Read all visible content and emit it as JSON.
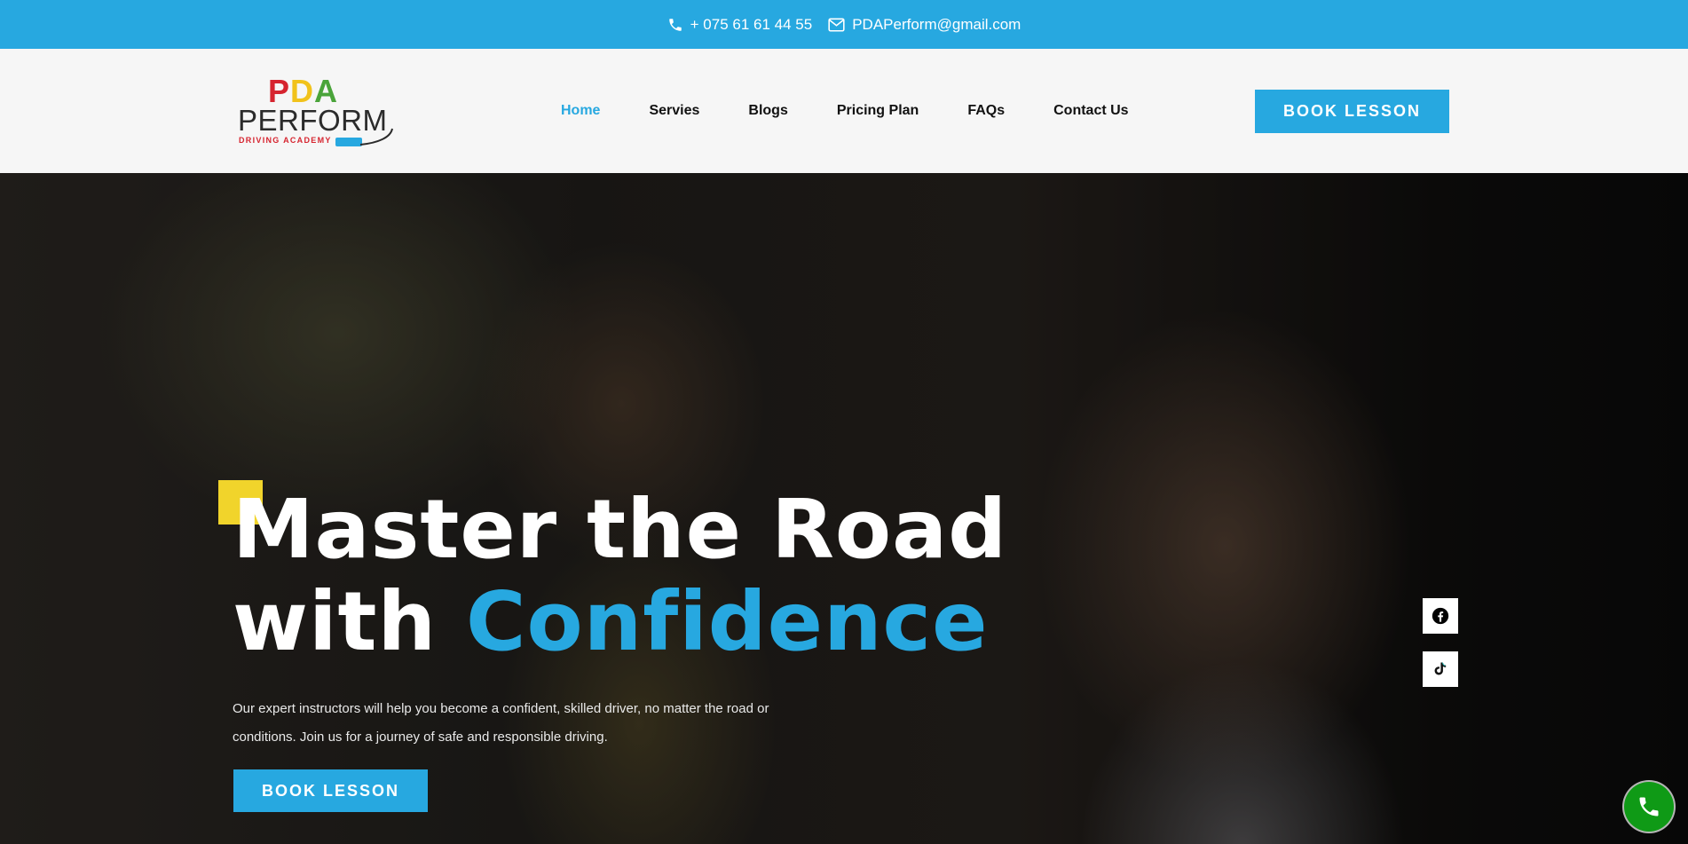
{
  "topbar": {
    "phone": "+ 075 61 61 44 55",
    "email": "PDAPerform@gmail.com",
    "phone_icon": "phone-icon",
    "email_icon": "envelope-icon",
    "bg_color": "#27a8e0"
  },
  "logo": {
    "top_letters": [
      "P",
      "D",
      "A"
    ],
    "top_colors": [
      "#d6242f",
      "#f1c21b",
      "#4aa43a"
    ],
    "main": "PERFORM",
    "tagline": "DRIVING ACADEMY"
  },
  "nav": {
    "items": [
      "Home",
      "Servies",
      "Blogs",
      "Pricing Plan",
      "FAQs",
      "Contact Us"
    ],
    "active_index": 0,
    "active_color": "#27a8e0"
  },
  "header": {
    "book_label": "BOOK LESSON"
  },
  "hero": {
    "headline_line1": "Master the Road",
    "headline_line2_prefix": "with ",
    "headline_highlight": "Confidence",
    "subtext_line1": "Our expert instructors will help you become a confident, skilled driver, no matter the road or",
    "subtext_line2": "conditions. Join us for a journey of safe and responsible driving.",
    "book_label": "BOOK LESSON",
    "accent_yellow": "#f1d42b"
  },
  "social": {
    "facebook_icon": "facebook-icon",
    "tiktok_icon": "tiktok-icon"
  },
  "fab": {
    "icon": "phone-icon",
    "color": "#0f9a16"
  }
}
